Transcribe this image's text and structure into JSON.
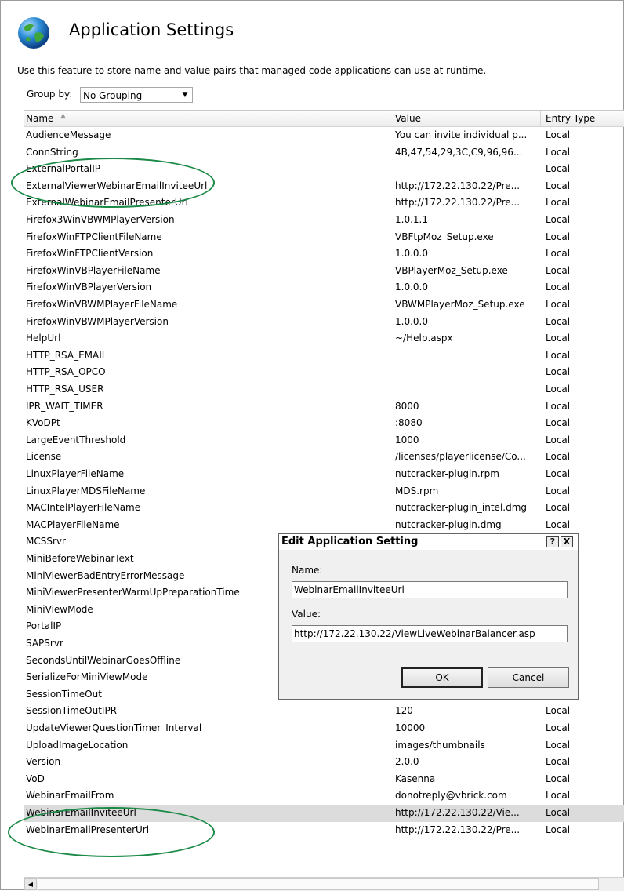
{
  "header": {
    "title": "Application Settings",
    "description": "Use this feature to store name and value pairs that managed code applications can use at runtime."
  },
  "group_by": {
    "label": "Group by:",
    "value": "No Grouping"
  },
  "columns": {
    "name": "Name",
    "value": "Value",
    "entry_type": "Entry Type"
  },
  "rows": [
    {
      "name": "AudienceMessage",
      "value": "You can invite individual p...",
      "type": "Local"
    },
    {
      "name": "ConnString",
      "value": "4B,47,54,29,3C,C9,96,96...",
      "type": "Local"
    },
    {
      "name": "ExternalPortalIP",
      "value": "",
      "type": "Local"
    },
    {
      "name": "ExternalViewerWebinarEmailInviteeUrl",
      "value": "http://172.22.130.22/Pre...",
      "type": "Local"
    },
    {
      "name": "ExternalWebinarEmailPresenterUrl",
      "value": "http://172.22.130.22/Pre...",
      "type": "Local"
    },
    {
      "name": "Firefox3WinVBWMPlayerVersion",
      "value": "1.0.1.1",
      "type": "Local"
    },
    {
      "name": "FirefoxWinFTPClientFileName",
      "value": "VBFtpMoz_Setup.exe",
      "type": "Local"
    },
    {
      "name": "FirefoxWinFTPClientVersion",
      "value": "1.0.0.0",
      "type": "Local"
    },
    {
      "name": "FirefoxWinVBPlayerFileName",
      "value": "VBPlayerMoz_Setup.exe",
      "type": "Local"
    },
    {
      "name": "FirefoxWinVBPlayerVersion",
      "value": "1.0.0.0",
      "type": "Local"
    },
    {
      "name": "FirefoxWinVBWMPlayerFileName",
      "value": "VBWMPlayerMoz_Setup.exe",
      "type": "Local"
    },
    {
      "name": "FirefoxWinVBWMPlayerVersion",
      "value": "1.0.0.0",
      "type": "Local"
    },
    {
      "name": "HelpUrl",
      "value": "~/Help.aspx",
      "type": "Local"
    },
    {
      "name": "HTTP_RSA_EMAIL",
      "value": "",
      "type": "Local"
    },
    {
      "name": "HTTP_RSA_OPCO",
      "value": "",
      "type": "Local"
    },
    {
      "name": "HTTP_RSA_USER",
      "value": "",
      "type": "Local"
    },
    {
      "name": "IPR_WAIT_TIMER",
      "value": "8000",
      "type": "Local"
    },
    {
      "name": "KVoDPt",
      "value": ":8080",
      "type": "Local"
    },
    {
      "name": "LargeEventThreshold",
      "value": "1000",
      "type": "Local"
    },
    {
      "name": "License",
      "value": "/licenses/playerlicense/Co...",
      "type": "Local"
    },
    {
      "name": "LinuxPlayerFileName",
      "value": "nutcracker-plugin.rpm",
      "type": "Local"
    },
    {
      "name": "LinuxPlayerMDSFileName",
      "value": "MDS.rpm",
      "type": "Local"
    },
    {
      "name": "MACIntelPlayerFileName",
      "value": "nutcracker-plugin_intel.dmg",
      "type": "Local"
    },
    {
      "name": "MACPlayerFileName",
      "value": "nutcracker-plugin.dmg",
      "type": "Local"
    },
    {
      "name": "MCSSrvr",
      "value": "",
      "type": ""
    },
    {
      "name": "MiniBeforeWebinarText",
      "value": "",
      "type": ""
    },
    {
      "name": "MiniViewerBadEntryErrorMessage",
      "value": "",
      "type": ""
    },
    {
      "name": "MiniViewerPresenterWarmUpPreparationTime",
      "value": "",
      "type": ""
    },
    {
      "name": "MiniViewMode",
      "value": "",
      "type": ""
    },
    {
      "name": "PortalIP",
      "value": "",
      "type": ""
    },
    {
      "name": "SAPSrvr",
      "value": "",
      "type": ""
    },
    {
      "name": "SecondsUntilWebinarGoesOffline",
      "value": "",
      "type": ""
    },
    {
      "name": "SerializeForMiniViewMode",
      "value": "",
      "type": ""
    },
    {
      "name": "SessionTimeOut",
      "value": "",
      "type": ""
    },
    {
      "name": "SessionTimeOutIPR",
      "value": "120",
      "type": "Local"
    },
    {
      "name": "UpdateViewerQuestionTimer_Interval",
      "value": "10000",
      "type": "Local"
    },
    {
      "name": "UploadImageLocation",
      "value": "images/thumbnails",
      "type": "Local"
    },
    {
      "name": "Version",
      "value": "2.0.0",
      "type": "Local"
    },
    {
      "name": "VoD",
      "value": "Kasenna",
      "type": "Local"
    },
    {
      "name": "WebinarEmailFrom",
      "value": "donotreply@vbrick.com",
      "type": "Local"
    },
    {
      "name": "WebinarEmailInviteeUrl",
      "value": "http://172.22.130.22/Vie...",
      "type": "Local"
    },
    {
      "name": "WebinarEmailPresenterUrl",
      "value": "http://172.22.130.22/Pre...",
      "type": "Local"
    }
  ],
  "selected_row": "WebinarEmailInviteeUrl",
  "dialog": {
    "title": "Edit Application Setting",
    "help_btn": "?",
    "close_btn": "X",
    "name_label": "Name:",
    "name_value": "WebinarEmailInviteeUrl",
    "value_label": "Value:",
    "value_value": "http://172.22.130.22/ViewLiveWebinarBalancer.asp",
    "ok": "OK",
    "cancel": "Cancel"
  },
  "colors": {
    "highlight_ellipse": "#1a8a46",
    "selected_row": "#dcdcdc"
  },
  "icons": {
    "header_icon": "globe-icon",
    "sort": "sort-ascending-icon",
    "dropdown": "chevron-down-icon"
  }
}
